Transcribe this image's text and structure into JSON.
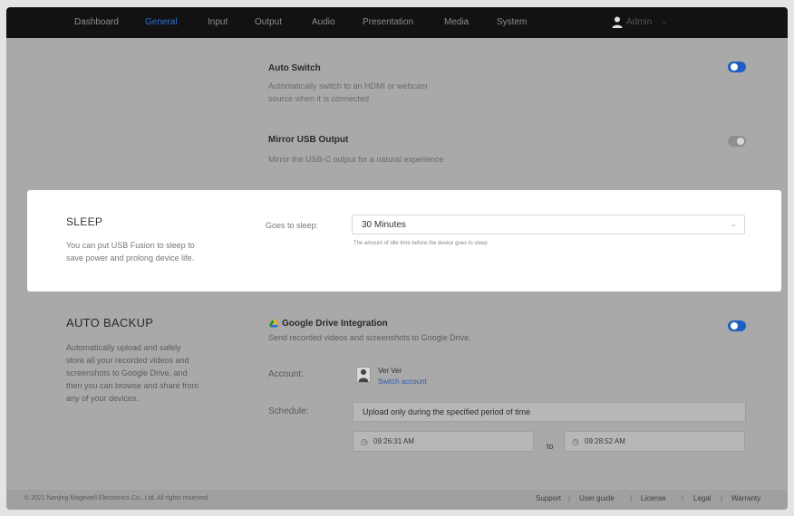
{
  "nav": {
    "items": [
      "Dashboard",
      "General",
      "Input",
      "Output",
      "Audio",
      "Presentation",
      "Media",
      "System"
    ],
    "active": "General",
    "user": "Admin"
  },
  "auto_switch": {
    "title": "Auto Switch",
    "desc_line1": "Automatically switch to an HDMI or webcam",
    "desc_line2": "source when it is connected",
    "enabled": true
  },
  "mirror_usb": {
    "title": "Mirror USB Output",
    "desc": "Mirror the USB-C output for a natural experience",
    "enabled": false
  },
  "sleep": {
    "title": "SLEEP",
    "desc_line1": "You can put USB Fusion to sleep to",
    "desc_line2": "save power and prolong device life.",
    "label": "Goes to sleep:",
    "value": "30 Minutes",
    "hint": "The amount of idle time before the device goes to sleep"
  },
  "backup": {
    "title": "AUTO BACKUP",
    "desc_lines": [
      "Automatically upload and safely",
      "store all your recorded videos and",
      "screenshots to Google Drive, and",
      "then you can browse and share from",
      "any of your devices."
    ],
    "gdrive_title": "Google Drive Integration",
    "gdrive_desc": "Send recorded videos and screenshots to Google Drive.",
    "gdrive_enabled": true,
    "account_label": "Account:",
    "account_name": "Ver Ver",
    "switch_account": "Switch account",
    "schedule_label": "Schedule:",
    "schedule_value": "Upload only during the specified period of time",
    "start_time": "09:26:31 AM",
    "to_label": "to",
    "end_time": "09:28:52 AM"
  },
  "footer": {
    "copyright": "© 2021 Nanjing Magewell Electronics Co., Ltd. All rights reserved.",
    "links": [
      "Support",
      "User guide",
      "License",
      "Legal",
      "Warranty"
    ]
  },
  "colors": {
    "accent": "#1d5fbf",
    "nav_bg": "#121212",
    "active_tab": "#2f6fd0"
  }
}
